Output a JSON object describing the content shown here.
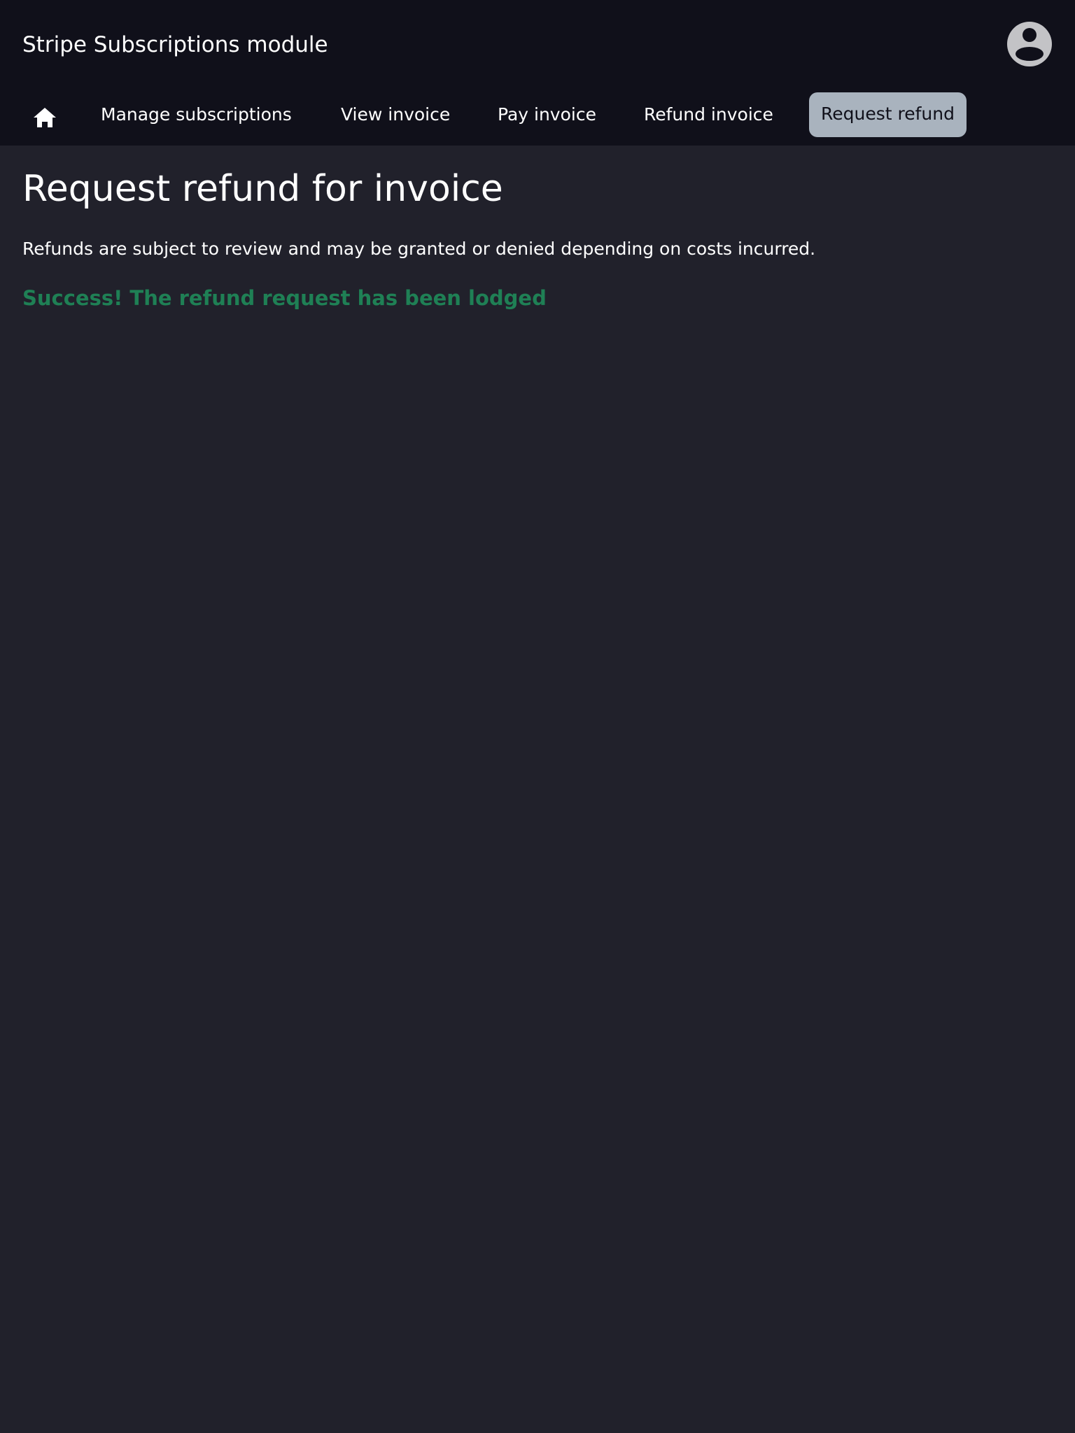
{
  "header": {
    "app_title": "Stripe Subscriptions module",
    "avatar_icon": "user-avatar-icon"
  },
  "nav": {
    "home_icon": "home-icon",
    "items": [
      {
        "label": "Manage subscriptions",
        "active": false
      },
      {
        "label": "View invoice",
        "active": false
      },
      {
        "label": "Pay invoice",
        "active": false
      },
      {
        "label": "Refund invoice",
        "active": false
      },
      {
        "label": "Request refund",
        "active": true
      }
    ]
  },
  "main": {
    "heading": "Request refund for invoice",
    "description": "Refunds are subject to review and may be granted or denied depending on costs incurred.",
    "success_message": "Success! The refund request has been lodged"
  },
  "colors": {
    "page_background": "#21212b",
    "header_background": "#10101a",
    "active_tab_background": "#a9b3be",
    "success_text": "#1f8055",
    "avatar": "#c3c3c6"
  }
}
